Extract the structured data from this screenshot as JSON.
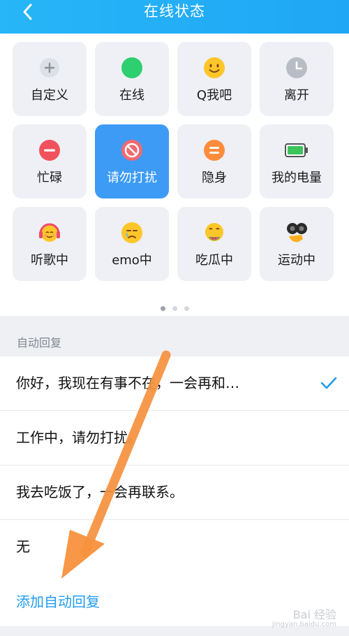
{
  "header": {
    "title": "在线状态"
  },
  "statuses": [
    {
      "label": "自定义",
      "icon": "plus-icon"
    },
    {
      "label": "在线",
      "icon": "online-dot-icon"
    },
    {
      "label": "Q我吧",
      "icon": "smile-face-icon"
    },
    {
      "label": "离开",
      "icon": "clock-icon"
    },
    {
      "label": "忙碌",
      "icon": "busy-minus-icon"
    },
    {
      "label": "请勿打扰",
      "icon": "do-not-disturb-icon",
      "selected": true
    },
    {
      "label": "隐身",
      "icon": "invisible-icon"
    },
    {
      "label": "我的电量",
      "icon": "battery-icon"
    },
    {
      "label": "听歌中",
      "icon": "headphones-face-icon"
    },
    {
      "label": "emo中",
      "icon": "sad-face-icon"
    },
    {
      "label": "吃瓜中",
      "icon": "eating-melon-face-icon"
    },
    {
      "label": "运动中",
      "icon": "binoculars-icon"
    }
  ],
  "pager": {
    "pages": 3,
    "current": 1
  },
  "auto_reply": {
    "section_label": "自动回复",
    "items": [
      {
        "text": "你好，我现在有事不在，一会再和…",
        "checked": true
      },
      {
        "text": "工作中，请勿打扰。",
        "checked": false
      },
      {
        "text": "我去吃饭了，一会再联系。",
        "checked": false
      },
      {
        "text": "无",
        "checked": false
      }
    ],
    "add_label": "添加自动回复"
  },
  "watermark": {
    "text": "Bai 经验",
    "sub": "jingyan.baidu.com"
  },
  "colors": {
    "header": "#1fa6f5",
    "selected_tile": "#3d9bf6",
    "accent": "#1f9cf0",
    "arrow": "#f7913d"
  }
}
